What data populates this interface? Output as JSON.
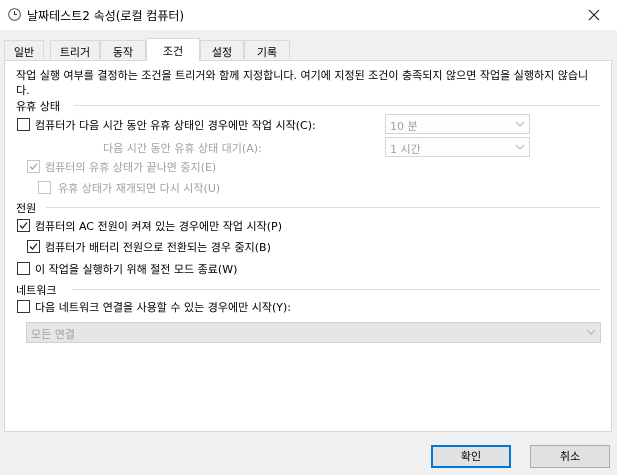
{
  "window": {
    "title": "날짜테스트2 속성(로컬 컴퓨터)",
    "icon": "clock-icon"
  },
  "tabs": [
    {
      "label": "일반",
      "active": false
    },
    {
      "label": "트리거",
      "active": false
    },
    {
      "label": "동작",
      "active": false
    },
    {
      "label": "조건",
      "active": true
    },
    {
      "label": "설정",
      "active": false
    },
    {
      "label": "기록",
      "active": false
    }
  ],
  "description": "작업 실행 여부를 결정하는 조건을 트리거와 함께 지정합니다. 여기에 지정된 조건이 충족되지 않으면 작업을 실행하지 않습니다.",
  "idle": {
    "heading": "유휴 상태",
    "start_only_if_idle": {
      "label": "컴퓨터가 다음 시간 동안 유휴 상태인 경우에만 작업 시작(C):",
      "checked": false,
      "enabled": true
    },
    "idle_duration": {
      "value": "10 분",
      "enabled": false
    },
    "wait_label": "다음 시간 동안 유휴 상태 대기(A):",
    "wait_duration": {
      "value": "1 시간",
      "enabled": false
    },
    "stop_if_not_idle": {
      "label": "컴퓨터의 유휴 상태가 끝나면 중지(E)",
      "checked": true,
      "enabled": false
    },
    "restart_if_idle": {
      "label": "유휴 상태가 재개되면 다시 시작(U)",
      "checked": false,
      "enabled": false
    }
  },
  "power": {
    "heading": "전원",
    "ac_only": {
      "label": "컴퓨터의 AC 전원이 켜져 있는 경우에만 작업 시작(P)",
      "checked": true,
      "enabled": true
    },
    "stop_on_battery": {
      "label": "컴퓨터가 배터리 전원으로 전환되는 경우 중지(B)",
      "checked": true,
      "enabled": true
    },
    "wake_to_run": {
      "label": "이 작업을 실행하기 위해 절전 모드 종료(W)",
      "checked": false,
      "enabled": true
    }
  },
  "network": {
    "heading": "네트워크",
    "network_only": {
      "label": "다음 네트워크 연결을 사용할 수 있는 경우에만 시작(Y):",
      "checked": false,
      "enabled": true
    },
    "connection": {
      "value": "모든 연결",
      "enabled": false
    }
  },
  "buttons": {
    "ok": "확인",
    "cancel": "취소"
  }
}
